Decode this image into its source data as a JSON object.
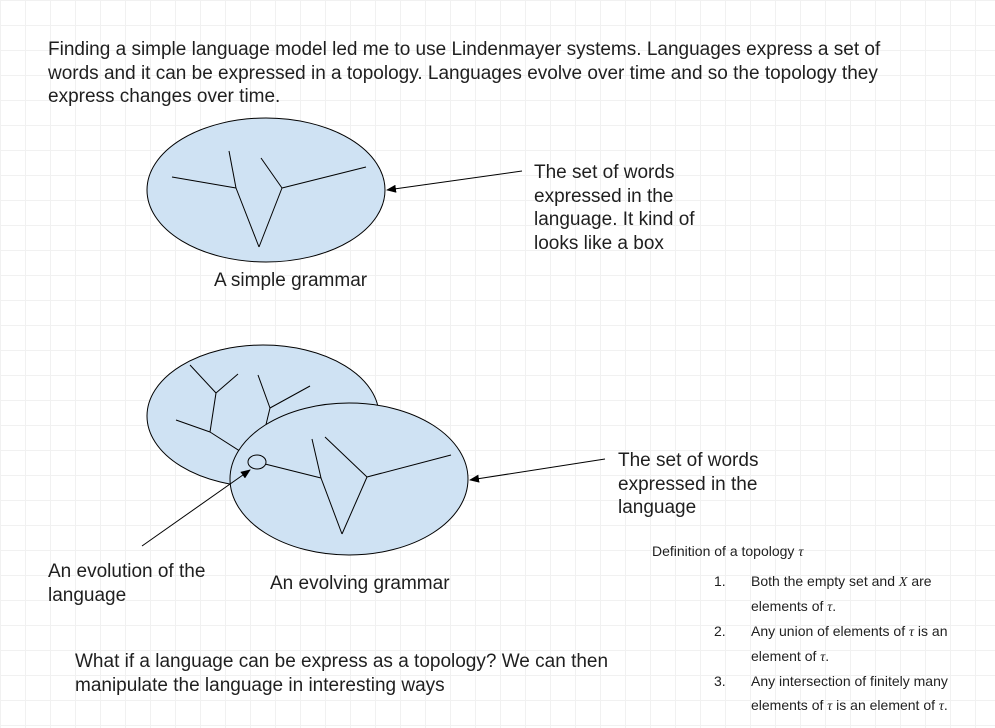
{
  "intro_text": "Finding a simple language model led me to use Lindenmayer systems. Languages express a set of words and it can be expressed in a topology. Languages evolve over time and so the topology they express changes over time.",
  "diagram1": {
    "callout": "The set of words expressed in the language. It kind of looks like a box",
    "label": "A simple grammar"
  },
  "diagram2": {
    "callout": "The set of words expressed in the language",
    "evolution_label": "An evolution of the language",
    "label": "An evolving grammar"
  },
  "question_text": "What if a language can be express as a topology? We can then manipulate the language in interesting ways",
  "definition": {
    "title": "Definition of a topology",
    "symbol": "τ",
    "items": [
      {
        "number": "1.",
        "before": "Both the empty set and ",
        "math": "X",
        "after": " are elements of ",
        "sym": "τ",
        "end": "."
      },
      {
        "number": "2.",
        "before": "Any union of elements of ",
        "math": "τ",
        "after": " is an element of ",
        "sym": "τ",
        "end": "."
      },
      {
        "number": "3.",
        "before": "Any intersection of finitely many elements of ",
        "math": "τ",
        "after": " is an element of ",
        "sym": "τ",
        "end": "."
      }
    ]
  },
  "colors": {
    "ellipse_fill": "#cfe2f3",
    "stroke": "#000000",
    "text": "#1f1f1f"
  }
}
